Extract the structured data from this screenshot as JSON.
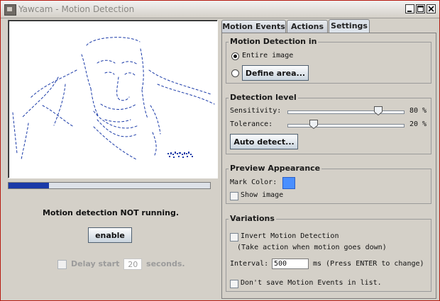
{
  "window": {
    "title": "Yawcam - Motion Detection",
    "icons": [
      "app-icon",
      "minimize-icon",
      "maximize-icon",
      "close-icon"
    ]
  },
  "left": {
    "motion_progress": 0.2,
    "status": "Motion detection NOT running.",
    "enable_label": "enable",
    "delay": {
      "label": "Delay start",
      "value": "20",
      "unit": "seconds.",
      "checked": false,
      "disabled": true
    }
  },
  "tabs": [
    {
      "label": "Motion Events",
      "active": false
    },
    {
      "label": "Actions",
      "active": false
    },
    {
      "label": "Settings",
      "active": true
    }
  ],
  "settings": {
    "motion_detection_in": {
      "title": "Motion Detection in",
      "entire_image": "Entire image",
      "entire_image_selected": true,
      "define_area": "Define area..."
    },
    "detection_level": {
      "title": "Detection level",
      "sensitivity_label": "Sensitivity:",
      "sensitivity_value": "80 %",
      "sensitivity": 80,
      "tolerance_label": "Tolerance:",
      "tolerance_value": "20 %",
      "tolerance": 20,
      "auto_detect": "Auto detect..."
    },
    "preview_appearance": {
      "title": "Preview Appearance",
      "mark_color_label": "Mark Color:",
      "mark_color": "#4a8fff",
      "show_image": "Show image",
      "show_image_checked": false
    },
    "variations": {
      "title": "Variations",
      "invert": "Invert Motion Detection",
      "invert_checked": false,
      "invert_note": "(Take action when motion goes down)",
      "interval_label": "Interval:",
      "interval_value": "500",
      "interval_note": "ms (Press ENTER to change)",
      "dont_save": "Don't save Motion Events in list.",
      "dont_save_checked": false
    }
  },
  "colors": {
    "window_border": "#b61a10",
    "motion_marks": "#1a3aa8",
    "progress_fill": "#1a3aa8"
  }
}
